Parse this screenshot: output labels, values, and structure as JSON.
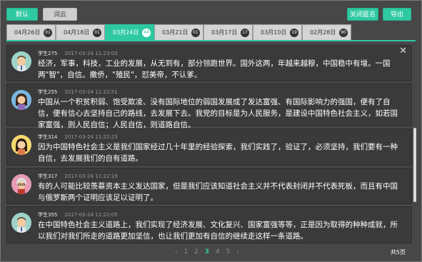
{
  "toolbar": {
    "default_label": "默认",
    "cloud_label": "词云",
    "anon_label": "关闭匿名",
    "export_label": "导出"
  },
  "tabs": [
    {
      "label": "04月26日",
      "count": "01"
    },
    {
      "label": "04月18日",
      "count": "01"
    },
    {
      "label": "03月24日",
      "count": "44"
    },
    {
      "label": "03月21日",
      "count": "01"
    },
    {
      "label": "03月17日",
      "count": "17"
    },
    {
      "label": "03月10日",
      "count": "19"
    },
    {
      "label": "02月28日",
      "count": "90"
    }
  ],
  "active_tab_index": 2,
  "messages": [
    {
      "student": "学生275",
      "time": "2017-03-24 11:23:03",
      "text": "经济，军事，科技，工业的发展，从无到有，部分领跑世界。国外这两，年越来越穆，中国稳中有增。一国两\"智\"，自信。撒侨，\"殖民\"，怼美帝，不认爹。",
      "avatar": "boy-avatar"
    },
    {
      "student": "学生255",
      "time": "2017-03-24 11:22:51",
      "text": "中国从一个积贫积弱、饱受欺凌、没有国际地位的弱国发展成了发达富强、有国际影响力的强国，便有了自信，便有信心去坚持自己的路线，去发展下去。我党的目标是为人民服务，是建设中国特色社会主义，如若国家富强，则人民自信；人民自信，则道路自信。",
      "avatar": "girl-avatar"
    },
    {
      "student": "学生314",
      "time": "2017-03-24 11:22:23",
      "text": "因为中国特色社会主义是我们国家经过几十年里的经验探索，我们实践了，验证了，必须坚持，我们要有一种自信，去发展我们的自有道路。",
      "avatar": "girl-avatar"
    },
    {
      "student": "学生317",
      "time": "2017-03-24 11:22:19",
      "text": "有的人可能比较羡慕资本主义发达国家，但是我们应该知道社会主义并不代表封闭并不代表死板，而且有中国与俄罗斯两个证明应该足以证明了。",
      "avatar": "grandma-avatar"
    },
    {
      "student": "学生355",
      "time": "2017-03-24 11:22:05",
      "text": "在中国特色社会主义道路上，我们实现了经济发展、文化复兴、国家富强等等，正是因为取得的种种成就，所以我们对我们所走的道路更加坚信，也让我们更加有自信的继续走这样一条道路。",
      "avatar": "boy-avatar"
    }
  ],
  "pager": {
    "prev": "‹",
    "pages": [
      "1",
      "2",
      "3",
      "4",
      "5"
    ],
    "current": "3",
    "next": "›",
    "total": "共5页"
  },
  "colors": {
    "accent": "#2fc9a1",
    "background": "#474747",
    "card": "#3a3a3a"
  }
}
